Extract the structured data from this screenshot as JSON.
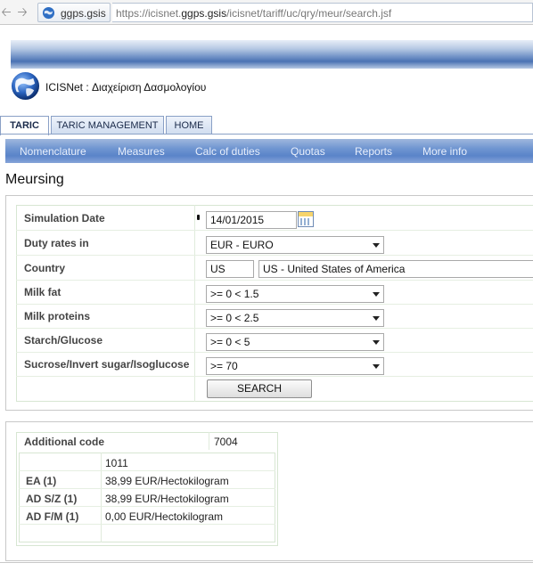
{
  "browser": {
    "site_name": "ggps.gsis",
    "url_prefix": "https://icisnet.",
    "url_domain": "ggps.gsis",
    "url_path": "/icisnet/tariff/uc/qry/meur/search.jsf"
  },
  "app": {
    "title": "ICISNet : Διαχείριση Δασμολογίου"
  },
  "tabs": [
    {
      "label": "TARIC",
      "active": true
    },
    {
      "label": "TARIC MANAGEMENT",
      "active": false
    },
    {
      "label": "HOME",
      "active": false
    }
  ],
  "menu": [
    "Nomenclature",
    "Measures",
    "Calc of duties",
    "Quotas",
    "Reports",
    "More info"
  ],
  "page_title": "Meursing",
  "form": {
    "simulation_date": {
      "label": "Simulation Date",
      "value": "14/01/2015"
    },
    "duty_rates": {
      "label": "Duty rates in",
      "value": "EUR - EURO"
    },
    "country": {
      "label": "Country",
      "code": "US",
      "name": "US - United States of America"
    },
    "milk_fat": {
      "label": "Milk fat",
      "value": ">= 0 < 1.5"
    },
    "milk_proteins": {
      "label": "Milk proteins",
      "value": ">= 0 < 2.5"
    },
    "starch": {
      "label": "Starch/Glucose",
      "value": ">= 0 < 5"
    },
    "sucrose": {
      "label": "Sucrose/Invert sugar/Isoglucose",
      "value": ">= 70"
    },
    "search_label": "SEARCH"
  },
  "results": {
    "additional_code_label": "Additional code",
    "additional_code_value": "7004",
    "column_header": "1011",
    "rows": [
      {
        "label": "EA (1)",
        "value": "38,99 EUR/Hectokilogram"
      },
      {
        "label": "AD S/Z (1)",
        "value": "38,99 EUR/Hectokilogram"
      },
      {
        "label": "AD F/M (1)",
        "value": "0,00 EUR/Hectokilogram"
      }
    ]
  },
  "colors": {
    "menu_bar": "#5a84c9",
    "tab_border": "#8aa0c6",
    "table_border": "#d7e6d2"
  }
}
